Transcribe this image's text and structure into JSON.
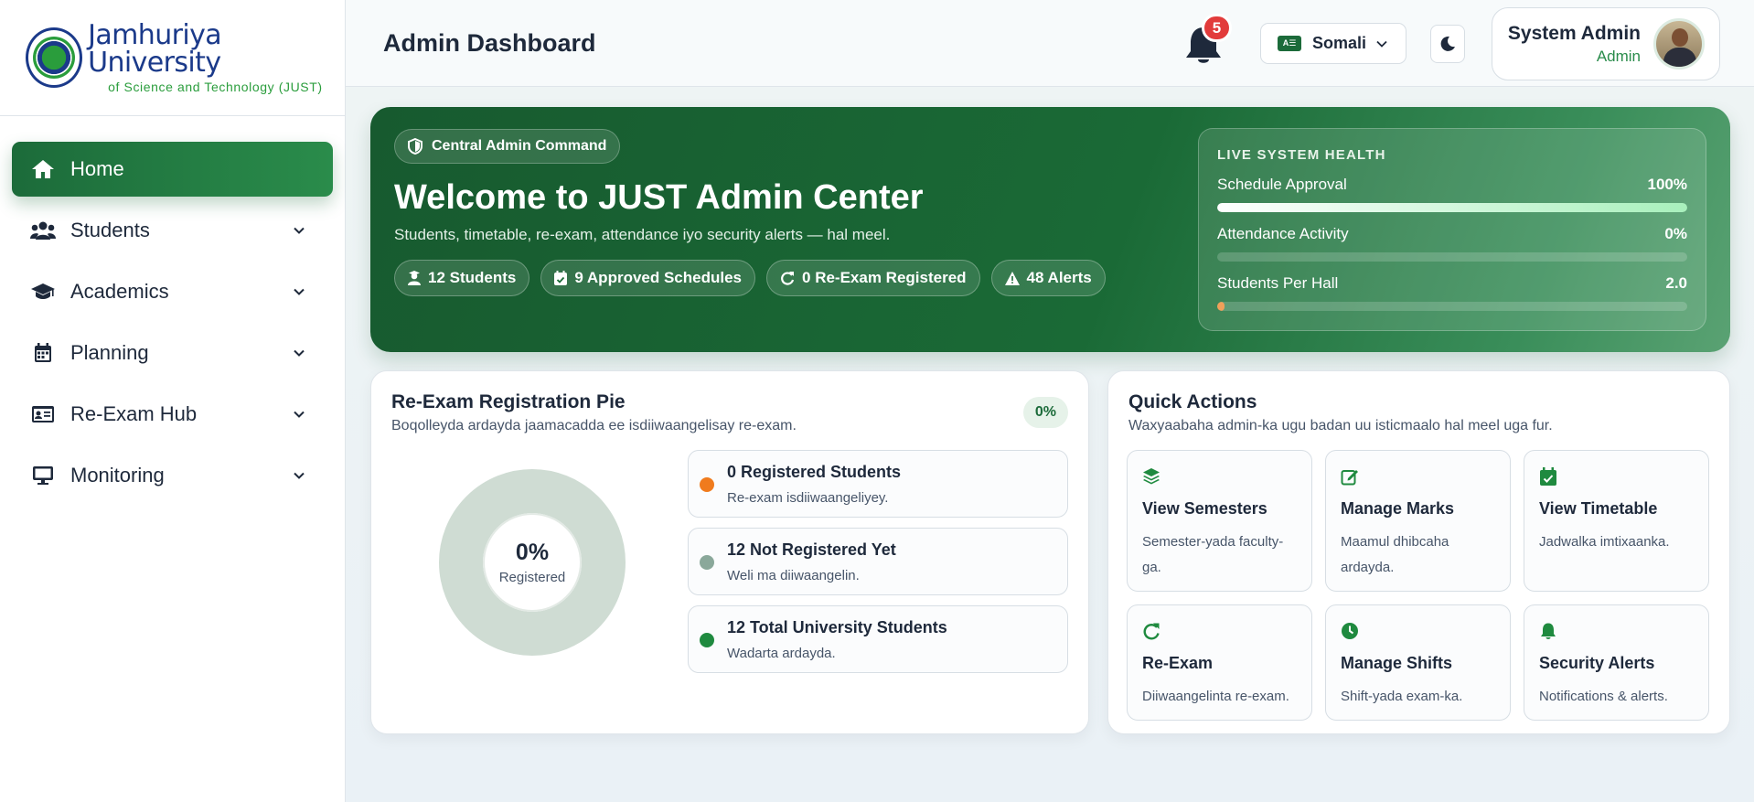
{
  "brand": {
    "name": "Jamhuriya University",
    "tagline": "of Science and Technology (JUST)"
  },
  "sidebar": {
    "items": [
      {
        "label": "Home",
        "icon": "home-icon",
        "active": true
      },
      {
        "label": "Students",
        "icon": "users-icon"
      },
      {
        "label": "Academics",
        "icon": "graduation-cap-icon"
      },
      {
        "label": "Planning",
        "icon": "calendar-icon"
      },
      {
        "label": "Re-Exam Hub",
        "icon": "id-card-icon"
      },
      {
        "label": "Monitoring",
        "icon": "monitor-icon"
      }
    ]
  },
  "header": {
    "title": "Admin Dashboard",
    "notifications": "5",
    "language": "Somali",
    "language_badge": "A☰",
    "user": {
      "name": "System Admin",
      "role": "Admin"
    }
  },
  "hero": {
    "tag": "Central Admin Command",
    "title": "Welcome to JUST Admin Center",
    "subtitle": "Students, timetable, re-exam, attendance iyo security alerts — hal meel.",
    "chips": [
      {
        "label": "12 Students",
        "icon": "user-graduate-icon"
      },
      {
        "label": "9 Approved Schedules",
        "icon": "calendar-check-icon"
      },
      {
        "label": "0 Re-Exam Registered",
        "icon": "refresh-icon"
      },
      {
        "label": "48 Alerts",
        "icon": "warning-icon"
      }
    ],
    "health": {
      "title": "LIVE SYSTEM HEALTH",
      "metrics": [
        {
          "label": "Schedule Approval",
          "value": "100%",
          "fill": 1.0
        },
        {
          "label": "Attendance Activity",
          "value": "0%",
          "fill": 0.0
        },
        {
          "label": "Students Per Hall",
          "value": "2.0",
          "fill": 0.01
        }
      ]
    }
  },
  "reexam": {
    "title": "Re-Exam Registration Pie",
    "subtitle": "Boqolleyda ardayda jaamacadda ee isdiiwaangelisay re-exam.",
    "badge": "0%",
    "center_pct": "0%",
    "center_label": "Registered",
    "registered_fraction": 0,
    "legend": [
      {
        "title": "0 Registered Students",
        "sub": "Re-exam isdiiwaangeliyey.",
        "color": "#f07b1d"
      },
      {
        "title": "12 Not Registered Yet",
        "sub": "Weli ma diiwaangelin.",
        "color": "#8aa89a"
      },
      {
        "title": "12 Total University Students",
        "sub": "Wadarta ardayda.",
        "color": "#1f8a3f"
      }
    ],
    "colors": {
      "track": "#cfdcd3",
      "accent": "#1c6b3a"
    }
  },
  "quick_actions": {
    "title": "Quick Actions",
    "subtitle": "Waxyaabaha admin-ka ugu badan uu isticmaalo hal meel uga fur.",
    "items": [
      {
        "title": "View Semesters",
        "desc": "Semester-yada faculty-ga.",
        "icon": "layers-icon"
      },
      {
        "title": "Manage Marks",
        "desc": "Maamul dhibcaha ardayda.",
        "icon": "edit-icon"
      },
      {
        "title": "View Timetable",
        "desc": "Jadwalka imtixaanka.",
        "icon": "calendar-check-icon"
      },
      {
        "title": "Re-Exam",
        "desc": "Diiwaangelinta re-exam.",
        "icon": "refresh-icon"
      },
      {
        "title": "Manage Shifts",
        "desc": "Shift-yada exam-ka.",
        "icon": "clock-icon"
      },
      {
        "title": "Security Alerts",
        "desc": "Notifications & alerts.",
        "icon": "bell-icon"
      }
    ]
  }
}
